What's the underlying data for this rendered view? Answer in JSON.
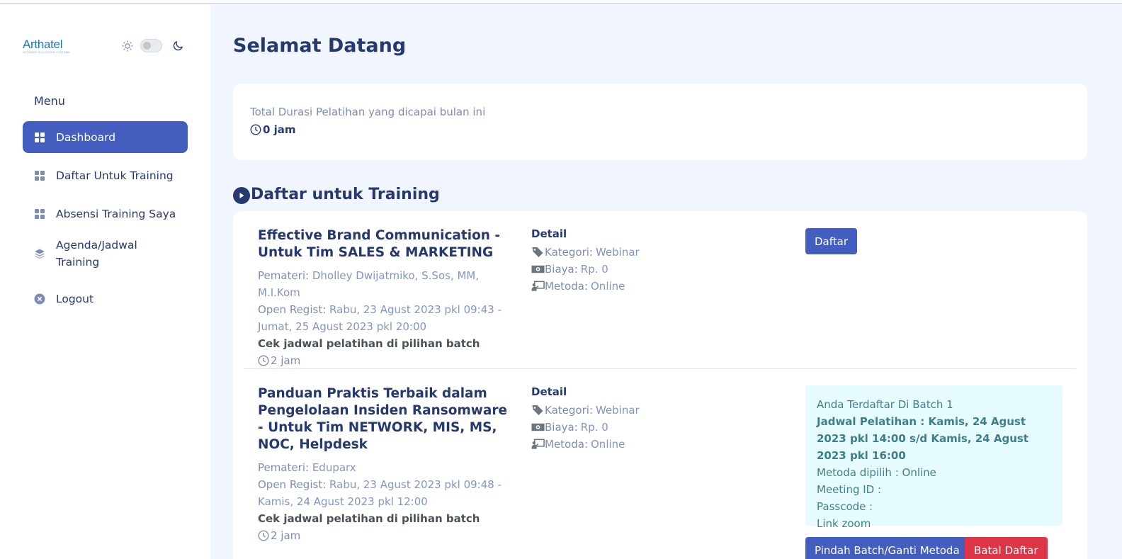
{
  "sidebar": {
    "logo": "Arthatel",
    "logo_tagline": "NETWORK SOLUTIONS SYSTEMS",
    "menu_title": "Menu",
    "items": [
      {
        "label": "Dashboard",
        "icon": "grid-icon",
        "active": true
      },
      {
        "label": "Daftar Untuk Training",
        "icon": "grid-icon",
        "active": false
      },
      {
        "label": "Absensi Training Saya",
        "icon": "grid-icon",
        "active": false
      },
      {
        "label": "Agenda/Jadwal Training",
        "icon": "stack-icon",
        "active": false
      },
      {
        "label": "Logout",
        "icon": "x-circle-icon",
        "active": false
      }
    ]
  },
  "header": {
    "title": "Selamat Datang"
  },
  "stats": {
    "label": "Total Durasi Pelatihan yang dicapai bulan ini",
    "value": "0 jam"
  },
  "section": {
    "title": "Daftar untuk Training"
  },
  "courses": [
    {
      "title": "Effective Brand Communication - Untuk Tim SALES & MARKETING",
      "pemateri_label": "Pemateri:",
      "pemateri": "Dholley Dwijatmiko, S.Sos, MM, M.I.Kom",
      "regist_label": "Open Regist:",
      "regist": "Rabu, 23 Agust 2023 pkl 09:43 - Jumat, 25 Agust 2023 pkl 20:00",
      "batch_note": "Cek jadwal pelatihan di pilihan batch",
      "duration": "2 jam",
      "detail_title": "Detail",
      "kategori_label": "Kategori:",
      "kategori": "Webinar",
      "biaya_label": "Biaya:",
      "biaya": "Rp. 0",
      "metoda_label": "Metoda:",
      "metoda": "Online",
      "action": "Daftar"
    },
    {
      "title": "Panduan Praktis Terbaik dalam Pengelolaan Insiden Ransomware - Untuk Tim NETWORK, MIS, MS, NOC, Helpdesk",
      "pemateri_label": "Pemateri:",
      "pemateri": "Eduparx",
      "regist_label": "Open Regist:",
      "regist": "Rabu, 23 Agust 2023 pkl 09:48 - Kamis, 24 Agust 2023 pkl 12:00",
      "batch_note": "Cek jadwal pelatihan di pilihan batch",
      "duration": "2 jam",
      "detail_title": "Detail",
      "kategori_label": "Kategori:",
      "kategori": "Webinar",
      "biaya_label": "Biaya:",
      "biaya": "Rp. 0",
      "metoda_label": "Metoda:",
      "metoda": "Online",
      "registration": {
        "batch": "Anda Terdaftar Di Batch 1",
        "schedule": "Jadwal Pelatihan : Kamis, 24 Agust 2023 pkl 14:00 s/d Kamis, 24 Agust 2023 pkl 16:00",
        "method": "Metoda dipilih : Online",
        "meeting_id": "Meeting ID :",
        "passcode": "Passcode :",
        "link": "Link zoom"
      },
      "move_button": "Pindah Batch/Ganti Metoda",
      "cancel_button": "Batal Daftar"
    }
  ],
  "colors": {
    "primary": "#435ebe",
    "danger": "#dc3545",
    "background": "#f1f6fe",
    "text": "#25396f",
    "muted": "#7c8db5",
    "info_bg": "#e5fbfd"
  }
}
